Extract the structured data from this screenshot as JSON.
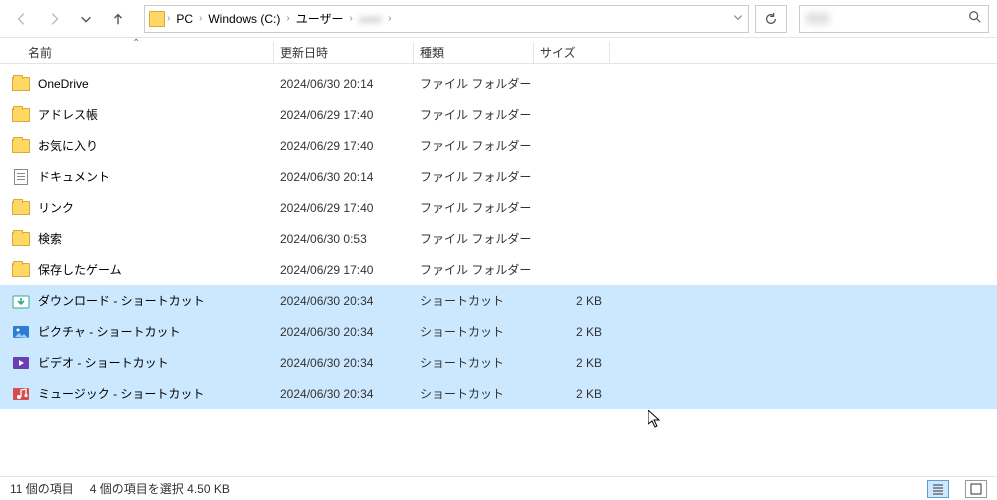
{
  "breadcrumb": {
    "items": [
      "PC",
      "Windows (C:)",
      "ユーザー"
    ],
    "lastBlurred": "user"
  },
  "search": {
    "placeholder": "検索"
  },
  "columns": {
    "name": "名前",
    "date": "更新日時",
    "type": "種類",
    "size": "サイズ"
  },
  "rows": [
    {
      "icon": "folder",
      "name": "OneDrive",
      "date": "2024/06/30 20:14",
      "type": "ファイル フォルダー",
      "size": "",
      "sel": false
    },
    {
      "icon": "folder",
      "name": "アドレス帳",
      "date": "2024/06/29 17:40",
      "type": "ファイル フォルダー",
      "size": "",
      "sel": false
    },
    {
      "icon": "folder",
      "name": "お気に入り",
      "date": "2024/06/29 17:40",
      "type": "ファイル フォルダー",
      "size": "",
      "sel": false
    },
    {
      "icon": "doc",
      "name": "ドキュメント",
      "date": "2024/06/30 20:14",
      "type": "ファイル フォルダー",
      "size": "",
      "sel": false
    },
    {
      "icon": "folder",
      "name": "リンク",
      "date": "2024/06/29 17:40",
      "type": "ファイル フォルダー",
      "size": "",
      "sel": false
    },
    {
      "icon": "folder",
      "name": "検索",
      "date": "2024/06/30 0:53",
      "type": "ファイル フォルダー",
      "size": "",
      "sel": false
    },
    {
      "icon": "folder",
      "name": "保存したゲーム",
      "date": "2024/06/29 17:40",
      "type": "ファイル フォルダー",
      "size": "",
      "sel": false
    },
    {
      "icon": "download",
      "name": "ダウンロード - ショートカット",
      "date": "2024/06/30 20:34",
      "type": "ショートカット",
      "size": "2 KB",
      "sel": true
    },
    {
      "icon": "pictures",
      "name": "ピクチャ - ショートカット",
      "date": "2024/06/30 20:34",
      "type": "ショートカット",
      "size": "2 KB",
      "sel": true
    },
    {
      "icon": "videos",
      "name": "ビデオ - ショートカット",
      "date": "2024/06/30 20:34",
      "type": "ショートカット",
      "size": "2 KB",
      "sel": true
    },
    {
      "icon": "music",
      "name": "ミュージック - ショートカット",
      "date": "2024/06/30 20:34",
      "type": "ショートカット",
      "size": "2 KB",
      "sel": true
    }
  ],
  "status": {
    "count": "11 個の項目",
    "selection": "4 個の項目を選択 4.50 KB"
  }
}
